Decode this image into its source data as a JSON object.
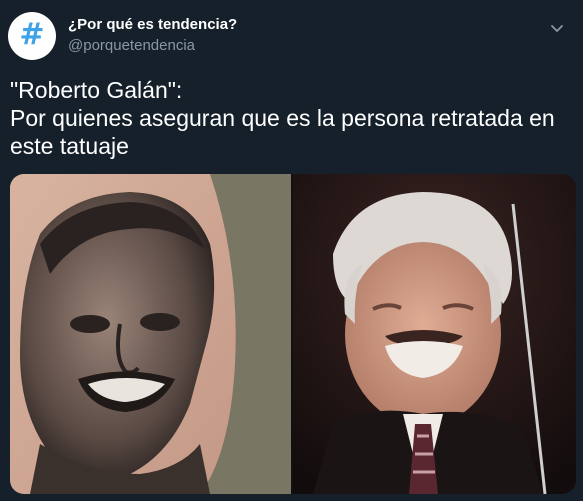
{
  "account": {
    "display_name": "¿Por qué es tendencia?",
    "handle": "@porquetendencia",
    "avatar_symbol": "#"
  },
  "tweet": {
    "line1": "\"Roberto Galán\":",
    "line2": "Por quienes aseguran que es la persona retratada en",
    "line3": "este tatuaje"
  },
  "media": {
    "images": [
      {
        "name": "tattoo-photo",
        "description_icon": "tattoo-portrait"
      },
      {
        "name": "portrait-photo",
        "description_icon": "smiling-man-portrait"
      }
    ]
  },
  "colors": {
    "background": "#15202b",
    "text": "#ffffff",
    "secondary_text": "#8899a6",
    "avatar_accent": "#3fa2e6"
  }
}
